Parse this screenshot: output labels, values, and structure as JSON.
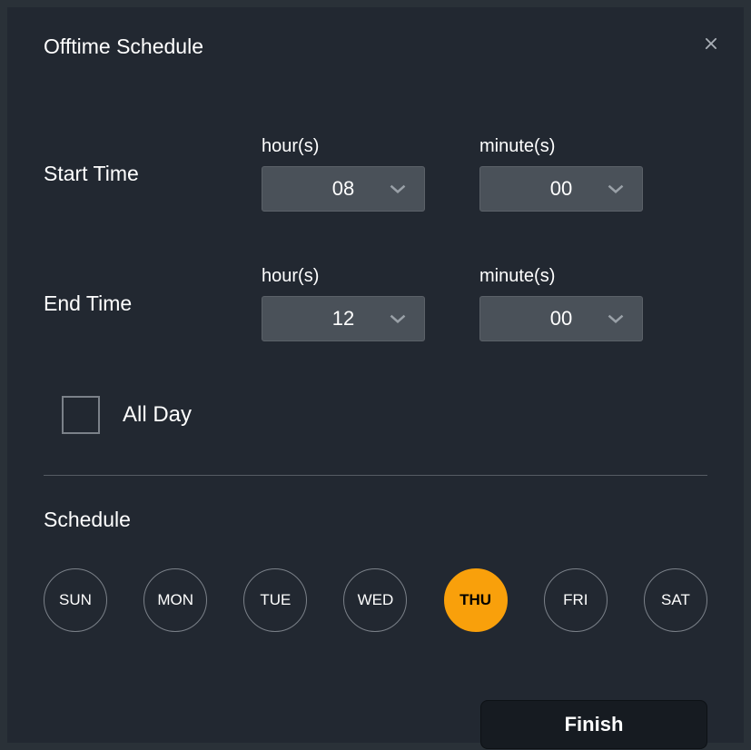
{
  "modal": {
    "title": "Offtime Schedule",
    "close_icon": "close"
  },
  "startTime": {
    "label": "Start Time",
    "hourLabel": "hour(s)",
    "hourValue": "08",
    "minuteLabel": "minute(s)",
    "minuteValue": "00"
  },
  "endTime": {
    "label": "End Time",
    "hourLabel": "hour(s)",
    "hourValue": "12",
    "minuteLabel": "minute(s)",
    "minuteValue": "00"
  },
  "allDay": {
    "label": "All Day",
    "checked": false
  },
  "schedule": {
    "title": "Schedule",
    "days": [
      "SUN",
      "MON",
      "TUE",
      "WED",
      "THU",
      "FRI",
      "SAT"
    ],
    "selected": "THU"
  },
  "actions": {
    "finish": "Finish"
  }
}
